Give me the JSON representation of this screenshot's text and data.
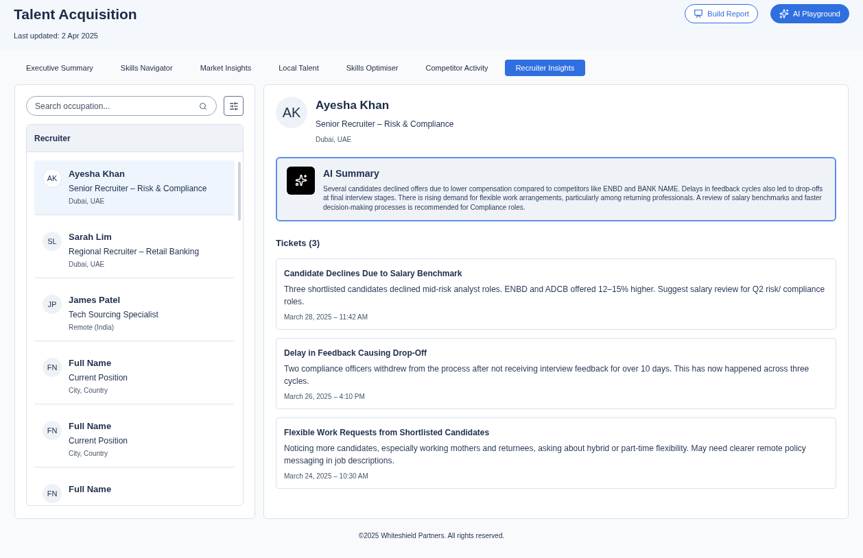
{
  "header": {
    "title": "Talent Acquisition",
    "updated": "Last updated: 2 Apr 2025",
    "buttons": [
      {
        "label": "Build Report",
        "kind": "outline"
      },
      {
        "label": "AI Playground",
        "kind": "primary"
      }
    ]
  },
  "tabs": [
    {
      "label": "Executive Summary",
      "selected": false
    },
    {
      "label": "Skills Navigator",
      "selected": false
    },
    {
      "label": "Market Insights",
      "selected": false
    },
    {
      "label": "Local Talent",
      "selected": false
    },
    {
      "label": "Skills Optimiser",
      "selected": false
    },
    {
      "label": "Competitor Activity",
      "selected": false
    },
    {
      "label": "Recruiter Insights",
      "selected": true
    }
  ],
  "sidebar": {
    "search": {
      "placeholder": "Search occupation..."
    },
    "list_title": "Recruiter",
    "items": [
      {
        "initials": "AK",
        "name": "Ayesha Khan",
        "position": "Senior Recruiter – Risk & Compliance",
        "location": "Dubai, UAE",
        "selected": true
      },
      {
        "initials": "SL",
        "name": "Sarah Lim",
        "position": "Regional Recruiter – Retail Banking",
        "location": "Dubai, UAE",
        "selected": false
      },
      {
        "initials": "JP",
        "name": "James Patel",
        "position": "Tech Sourcing Specialist",
        "location": "Remote (India)",
        "selected": false
      },
      {
        "initials": "FN",
        "name": "Full Name",
        "position": "Current Position",
        "location": "City, Country",
        "selected": false
      },
      {
        "initials": "FN",
        "name": "Full Name",
        "position": "Current Position",
        "location": "City, Country",
        "selected": false
      },
      {
        "initials": "FN",
        "name": "Full Name",
        "selected": false
      }
    ]
  },
  "profile": {
    "initials": "AK",
    "name": "Ayesha Khan",
    "position": "Senior Recruiter – Risk & Compliance",
    "location": "Dubai, UAE"
  },
  "ai_summary": {
    "title": "AI Summary",
    "text": "Several candidates declined offers due to lower compensation compared to competitors like ENBD and BANK NAME. Delays in feedback cycles also led to drop-offs at final interview stages. There is rising demand for flexible work arrangements, particularly among returning professionals. A review of salary benchmarks and faster decision-making processes is recommended for Compliance roles."
  },
  "tickets": {
    "title": "Tickets (3)",
    "items": [
      {
        "title": "Candidate Declines Due to Salary Benchmark",
        "text": "Three shortlisted candidates declined mid-risk analyst roles. ENBD and ADCB offered 12–15% higher. Suggest salary review for Q2 risk/ compliance roles.",
        "time": "March 28, 2025 – 11:42 AM"
      },
      {
        "title": "Delay in Feedback Causing Drop-Off",
        "text": "Two compliance officers withdrew from the process after not receiving interview feedback for over 10 days. This has now happened across three cycles.",
        "time": "March 26, 2025 – 4:10 PM"
      },
      {
        "title": "Flexible Work Requests from Shortlisted Candidates",
        "text": "Noticing more candidates, especially working mothers and returnees, asking about hybrid or part-time flexibility. May need clearer remote policy messaging in job descriptions.",
        "time": "March 24, 2025 – 10:30 AM"
      }
    ]
  },
  "footer": "©2025 Whiteshield Partners. All rights reserved."
}
